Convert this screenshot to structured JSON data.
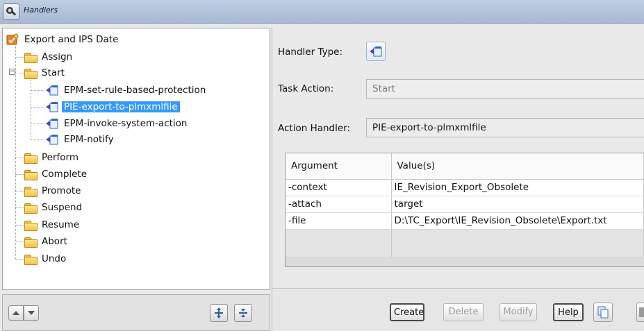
{
  "window": {
    "title": "Handlers"
  },
  "tree": {
    "root": {
      "label": "Export and IPS Date"
    },
    "items": [
      {
        "label": "Assign"
      },
      {
        "label": "Start"
      },
      {
        "label": "EPM-set-rule-based-protection"
      },
      {
        "label": "PIE-export-to-plmxmlfile"
      },
      {
        "label": "EPM-invoke-system-action"
      },
      {
        "label": "EPM-notify"
      },
      {
        "label": "Perform"
      },
      {
        "label": "Complete"
      },
      {
        "label": "Promote"
      },
      {
        "label": "Suspend"
      },
      {
        "label": "Resume"
      },
      {
        "label": "Abort"
      },
      {
        "label": "Undo"
      }
    ]
  },
  "form": {
    "handler_type_label": "Handler Type:",
    "task_action_label": "Task Action:",
    "task_action_value": "Start",
    "action_handler_label": "Action Handler:",
    "action_handler_value": "PIE-export-to-plmxmlfile"
  },
  "arguments": {
    "headers": [
      "Argument",
      "Value(s)"
    ],
    "rows": [
      [
        "-context",
        "IE_Revision_Export_Obsolete"
      ],
      [
        "-attach",
        "target"
      ],
      [
        "-file",
        "D:\\TC_Export\\IE_Revision_Obsolete\\Export.txt"
      ]
    ]
  },
  "buttons": {
    "create": "Create",
    "delete": "Delete",
    "modify": "Modify",
    "help": "Help"
  }
}
